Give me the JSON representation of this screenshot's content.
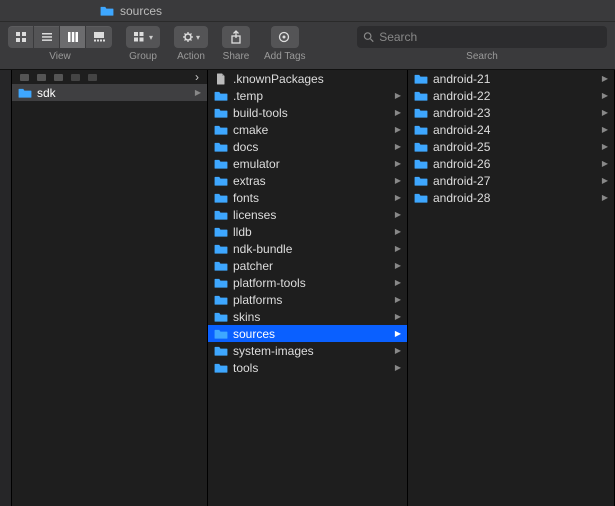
{
  "window": {
    "title": "sources"
  },
  "toolbar": {
    "view_label": "View",
    "group_label": "Group",
    "action_label": "Action",
    "share_label": "Share",
    "tags_label": "Add Tags",
    "search_label": "Search",
    "search_placeholder": "Search"
  },
  "columns": {
    "col1": [
      {
        "name": "sdk",
        "kind": "folder",
        "selected": true,
        "has_children": true
      }
    ],
    "col2": [
      {
        "name": ".knownPackages",
        "kind": "file",
        "has_children": false
      },
      {
        "name": ".temp",
        "kind": "folder",
        "has_children": true
      },
      {
        "name": "build-tools",
        "kind": "folder",
        "has_children": true
      },
      {
        "name": "cmake",
        "kind": "folder",
        "has_children": true
      },
      {
        "name": "docs",
        "kind": "folder",
        "has_children": true
      },
      {
        "name": "emulator",
        "kind": "folder",
        "has_children": true
      },
      {
        "name": "extras",
        "kind": "folder",
        "has_children": true
      },
      {
        "name": "fonts",
        "kind": "folder",
        "has_children": true
      },
      {
        "name": "licenses",
        "kind": "folder",
        "has_children": true
      },
      {
        "name": "lldb",
        "kind": "folder",
        "has_children": true
      },
      {
        "name": "ndk-bundle",
        "kind": "folder",
        "has_children": true
      },
      {
        "name": "patcher",
        "kind": "folder",
        "has_children": true
      },
      {
        "name": "platform-tools",
        "kind": "folder",
        "has_children": true
      },
      {
        "name": "platforms",
        "kind": "folder",
        "has_children": true
      },
      {
        "name": "skins",
        "kind": "folder",
        "has_children": true
      },
      {
        "name": "sources",
        "kind": "folder",
        "has_children": true,
        "selected": true
      },
      {
        "name": "system-images",
        "kind": "folder",
        "has_children": true
      },
      {
        "name": "tools",
        "kind": "folder",
        "has_children": true
      }
    ],
    "col3": [
      {
        "name": "android-21",
        "kind": "folder",
        "has_children": true
      },
      {
        "name": "android-22",
        "kind": "folder",
        "has_children": true
      },
      {
        "name": "android-23",
        "kind": "folder",
        "has_children": true
      },
      {
        "name": "android-24",
        "kind": "folder",
        "has_children": true
      },
      {
        "name": "android-25",
        "kind": "folder",
        "has_children": true
      },
      {
        "name": "android-26",
        "kind": "folder",
        "has_children": true
      },
      {
        "name": "android-27",
        "kind": "folder",
        "has_children": true
      },
      {
        "name": "android-28",
        "kind": "folder",
        "has_children": true
      }
    ]
  },
  "colors": {
    "selection": "#0a60ff",
    "folder": "#3ea7ff",
    "bg": "#1e1e1e",
    "toolbar": "#3a3a3c"
  }
}
